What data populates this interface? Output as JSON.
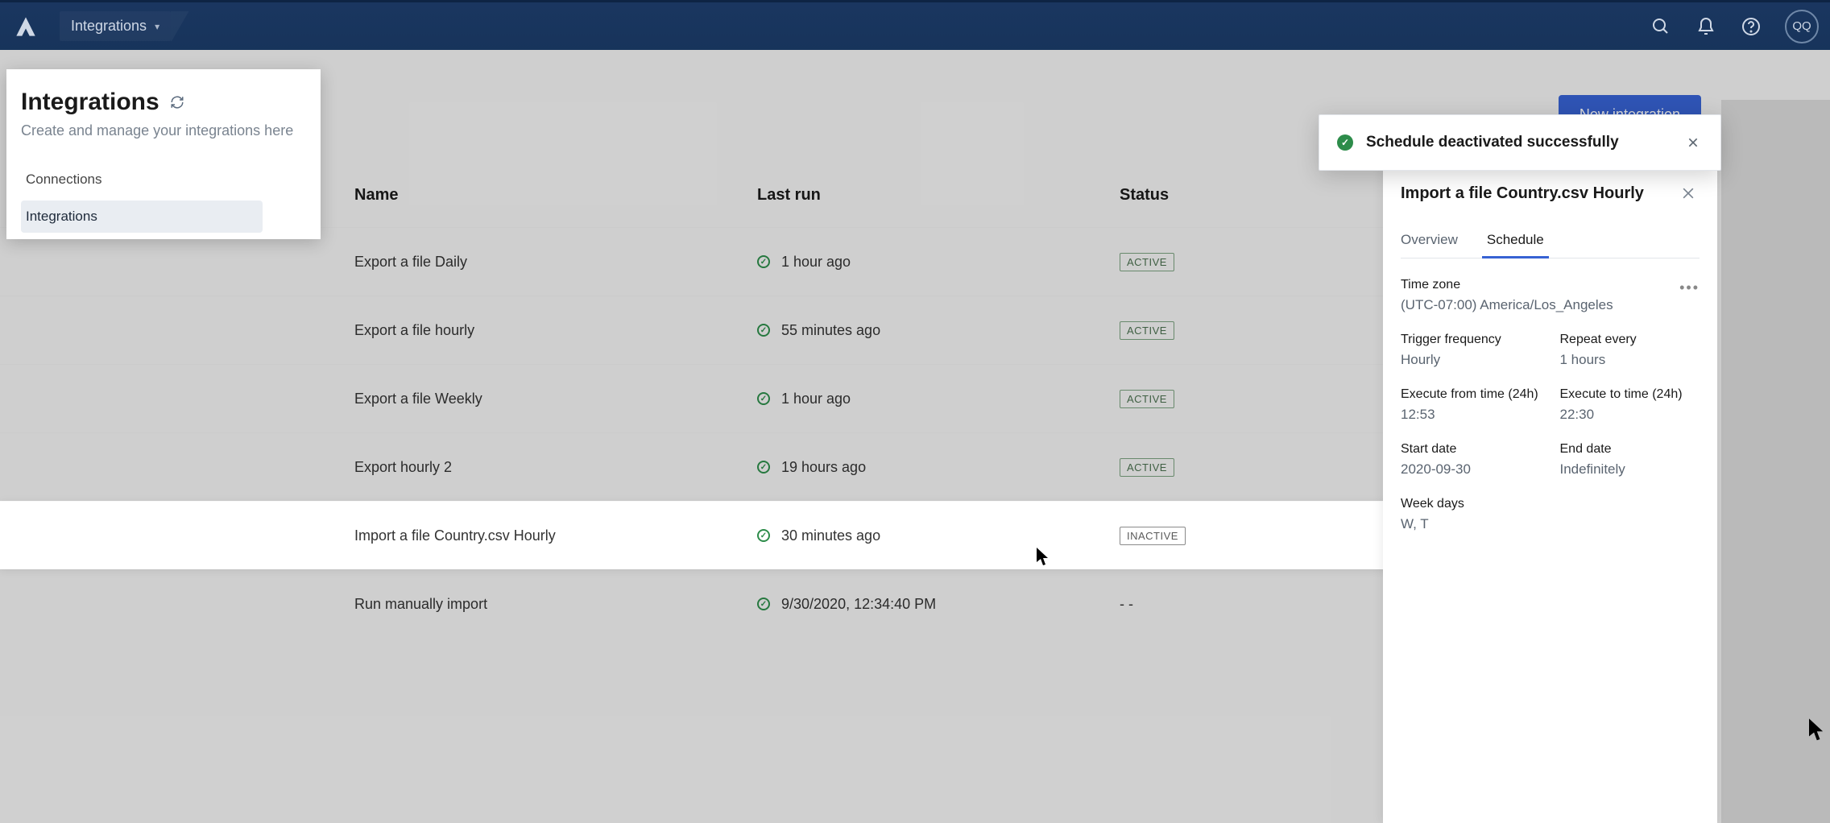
{
  "nav": {
    "breadcrumb": "Integrations",
    "avatar_initials": "QQ"
  },
  "left_panel": {
    "title": "Integrations",
    "subtitle": "Create and manage your integrations here",
    "links": [
      {
        "label": "Connections",
        "active": false
      },
      {
        "label": "Integrations",
        "active": true
      }
    ]
  },
  "buttons": {
    "new_integration": "New integration"
  },
  "list": {
    "headers": {
      "name": "Name",
      "last_run": "Last run",
      "status": "Status"
    },
    "rows": [
      {
        "name": "Export a file Daily",
        "last_run": "1 hour ago",
        "status": "ACTIVE",
        "status_kind": "active",
        "selected": false
      },
      {
        "name": "Export a file hourly",
        "last_run": "55 minutes ago",
        "status": "ACTIVE",
        "status_kind": "active",
        "selected": false
      },
      {
        "name": "Export a file Weekly",
        "last_run": "1 hour ago",
        "status": "ACTIVE",
        "status_kind": "active",
        "selected": false
      },
      {
        "name": "Export hourly 2",
        "last_run": "19 hours ago",
        "status": "ACTIVE",
        "status_kind": "active",
        "selected": false
      },
      {
        "name": "Import a file Country.csv Hourly",
        "last_run": "30 minutes ago",
        "status": "INACTIVE",
        "status_kind": "inactive",
        "selected": true
      },
      {
        "name": "Run manually import",
        "last_run": "9/30/2020, 12:34:40 PM",
        "status": "- -",
        "status_kind": "none",
        "selected": false
      }
    ]
  },
  "detail": {
    "title": "Import a file Country.csv Hourly",
    "tabs": {
      "overview": "Overview",
      "schedule": "Schedule",
      "active": "schedule"
    },
    "fields": {
      "time_zone": {
        "label": "Time zone",
        "value": "(UTC-07:00) America/Los_Angeles"
      },
      "trigger_frequency": {
        "label": "Trigger frequency",
        "value": "Hourly"
      },
      "repeat_every": {
        "label": "Repeat every",
        "value": "1 hours"
      },
      "execute_from": {
        "label": "Execute from time (24h)",
        "value": "12:53"
      },
      "execute_to": {
        "label": "Execute to time (24h)",
        "value": "22:30"
      },
      "start_date": {
        "label": "Start date",
        "value": "2020-09-30"
      },
      "end_date": {
        "label": "End date",
        "value": "Indefinitely"
      },
      "week_days": {
        "label": "Week days",
        "value": "W, T"
      }
    }
  },
  "toast": {
    "message": "Schedule deactivated successfully"
  }
}
